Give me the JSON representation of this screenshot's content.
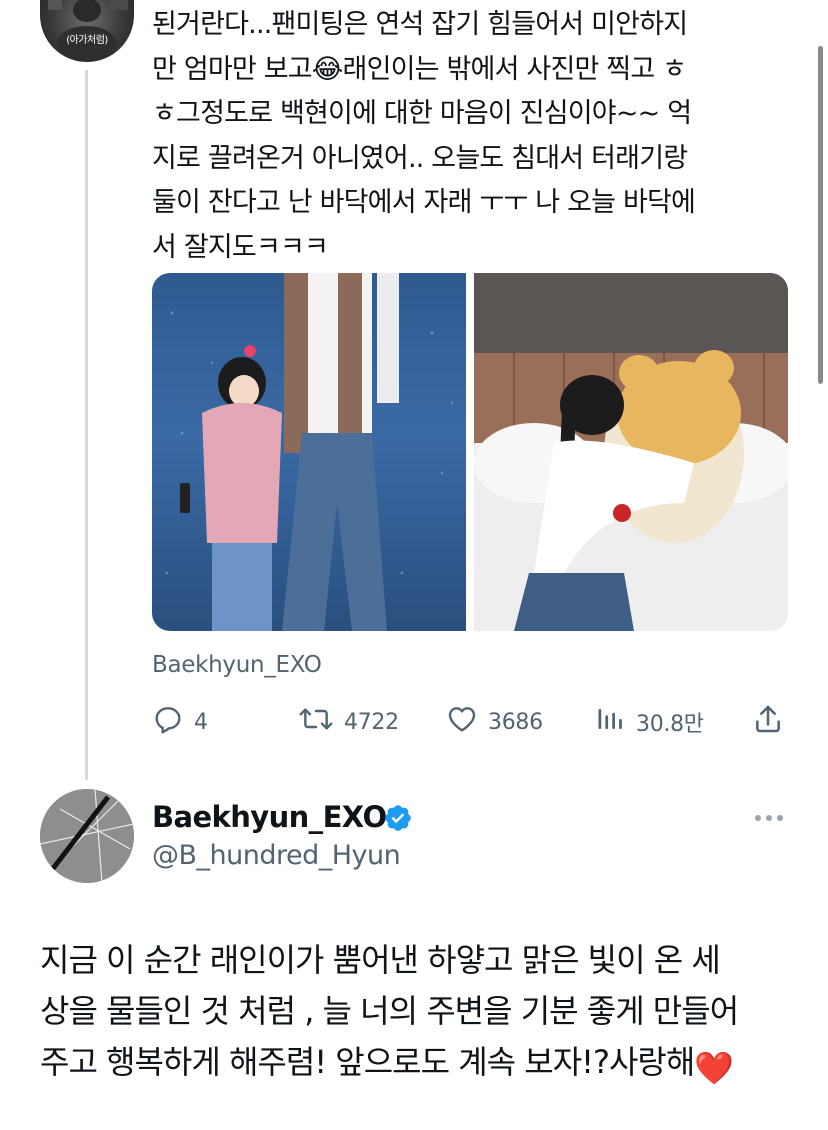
{
  "reply_context": {
    "avatar_caption": "(아가처럼)",
    "text": "된거란다...팬미팅은 연석 잡기 힘들어서 미안하지\n만 엄마만 보고😂래인이는 밖에서 사진만 찍고 ㅎ\nㅎ그정도로 백현이에 대한 마음이 진심이야~~ 억\n지로 끌려온거 아니였어.. 오늘도 침대서 터래기랑\n둘이 잔다고 난 바닥에서 자래 ㅜㅜ 나 오늘 바닥에\n서 잘지도ㅋㅋㅋ",
    "source_label": "Baekhyun_EXO",
    "actions": {
      "reply_count": "4",
      "retweet_count": "4722",
      "like_count": "3686",
      "view_count": "30.8만"
    }
  },
  "main_tweet": {
    "display_name": "Baekhyun_EXO",
    "handle": "@B_hundred_Hyun",
    "text": "지금 이 순간 래인이가 뿜어낸 하얗고 맑은 빛이 온 세\n상을 물들인 것 처럼 , 늘 너의 주변을 기분 좋게 만들어\n주고 행복하게 해주렴! 앞으로도 계속 보자!?사랑해",
    "trailing_emoji": "❤️"
  },
  "icons": {
    "reply": "reply-icon",
    "retweet": "retweet-icon",
    "like": "heart-icon",
    "views": "views-icon",
    "share": "share-icon",
    "verified": "verified-badge-icon",
    "more": "more-dots-icon"
  },
  "colors": {
    "text_primary": "#0f1419",
    "text_secondary": "#536471",
    "verified_blue": "#1d9bf0",
    "thread_line": "#cfd9de",
    "heart_red": "#e0201f"
  }
}
